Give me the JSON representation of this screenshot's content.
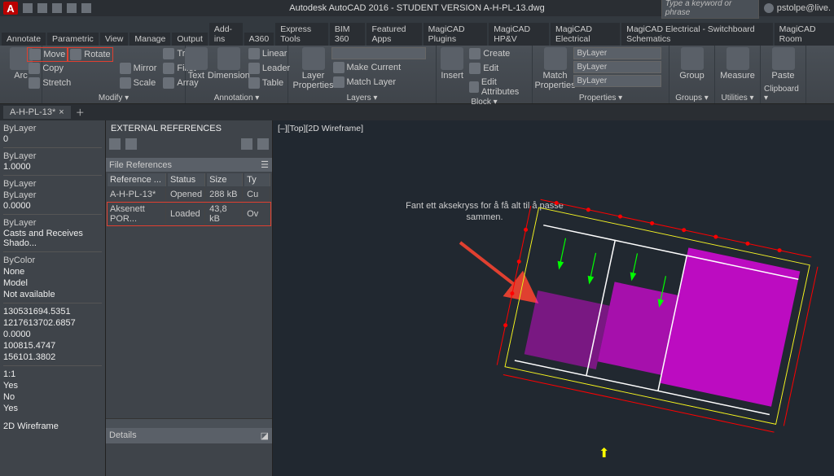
{
  "app": {
    "title": "Autodesk AutoCAD 2016 - STUDENT VERSION   A-H-PL-13.dwg",
    "search_placeholder": "Type a keyword or phrase",
    "user": "pstolpe@live.",
    "app_button": "A"
  },
  "menubar": [
    "",
    "",
    "",
    "",
    "",
    "",
    ""
  ],
  "ribbon_tabs": [
    "Annotate",
    "Parametric",
    "View",
    "Manage",
    "Output",
    "Add-ins",
    "A360",
    "Express Tools",
    "BIM 360",
    "Featured Apps",
    "MagiCAD Plugins",
    "MagiCAD HP&V",
    "MagiCAD Electrical",
    "MagiCAD Electrical - Switchboard Schematics",
    "MagiCAD Room"
  ],
  "ribbon": {
    "arc": "Arc",
    "move": "Move",
    "rotate": "Rotate",
    "trim": "Trim",
    "copy": "Copy",
    "mirror": "Mirror",
    "fillet": "Fillet",
    "stretch": "Stretch",
    "scale": "Scale",
    "array": "Array",
    "modify": "Modify ▾",
    "text": "Text",
    "dimension": "Dimension",
    "linear": "Linear",
    "leader": "Leader",
    "table": "Table",
    "annotation": "Annotation ▾",
    "layer_properties": "Layer\nProperties",
    "make_current": "Make Current",
    "match_layer": "Match Layer",
    "layers": "Layers ▾",
    "insert": "Insert",
    "create": "Create",
    "edit": "Edit",
    "edit_attr": "Edit Attributes",
    "block": "Block ▾",
    "match_props": "Match\nProperties",
    "bylayer": "ByLayer",
    "properties": "Properties ▾",
    "group": "Group",
    "groups": "Groups ▾",
    "measure": "Measure",
    "utilities": "Utilities ▾",
    "paste": "Paste",
    "clipboard": "Clipboard ▾"
  },
  "file_tabs": {
    "current": "A-H-PL-13*"
  },
  "props": {
    "bylayer1": "ByLayer",
    "v0": "0",
    "bylayer2": "ByLayer",
    "v1": "1.0000",
    "bylayer3": "ByLayer",
    "v2": "ByLayer",
    "v3": "0.0000",
    "bylayer4": "ByLayer",
    "shadow": "Casts and Receives Shado...",
    "bycolor": "ByColor",
    "none": "None",
    "model": "Model",
    "na": "Not available",
    "n1": "130531694.5351",
    "n2": "1217613702.6857",
    "n3": "0.0000",
    "n4": "100815.4747",
    "n5": "156101.3802",
    "r1": "1:1",
    "r2": "Yes",
    "r3": "No",
    "r4": "Yes",
    "wire": "2D Wireframe"
  },
  "xref": {
    "title": "EXTERNAL REFERENCES",
    "section": "File References",
    "cols": [
      "Reference ...",
      "Status",
      "Size",
      "Ty"
    ],
    "rows": [
      {
        "name": "A-H-PL-13*",
        "status": "Opened",
        "size": "288 kB",
        "ty": "Cu"
      },
      {
        "name": "Aksenett POR...",
        "status": "Loaded",
        "size": "43,8 kB",
        "ty": "Ov"
      }
    ],
    "details": "Details"
  },
  "canvas": {
    "view_label": "[–][Top][2D Wireframe]",
    "annotation_line1": "Fant ett aksekryss for å få alt til å passe",
    "annotation_line2": "sammen."
  }
}
